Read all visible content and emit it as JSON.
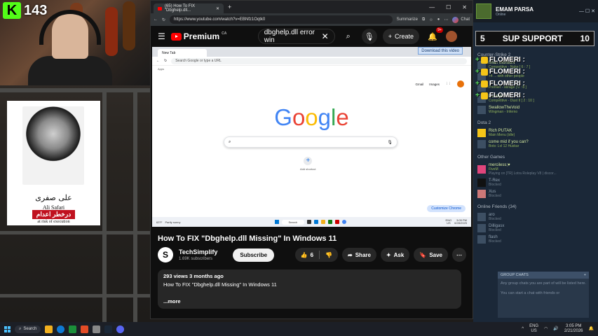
{
  "kick": {
    "count": "143"
  },
  "poster": {
    "name_fa": "علی صفری",
    "name_en": "Ali Safari",
    "red_label": "درخطر اعدام",
    "subtitle": "at risk of execution"
  },
  "browser": {
    "tab_title": "(65) How To FIX \"Dbghelp.dll...",
    "url": "https://www.youtube.com/watch?v=EBNfz1Oqtk0",
    "summarize": "Summarize",
    "chat": "Chat"
  },
  "youtube": {
    "logo": "Premium",
    "region": "CA",
    "search_value": "dbghelp.dll error win",
    "create_label": "Create",
    "notif_count": "9+",
    "video_title": "How To FIX \"Dbghelp.dll Missing\" In Windows 11",
    "channel_name": "TechSimplify",
    "subscribers": "1.69K subscribers",
    "subscribe_label": "Subscribe",
    "likes": "6",
    "share_label": "Share",
    "ask_label": "Ask",
    "save_label": "Save",
    "desc_stats": "293 views  3 months ago",
    "desc_text": "How To FIX \"Dbghelp.dll Missing\" In Windows 11",
    "more_label": "...more"
  },
  "inner": {
    "tab": "New Tab",
    "download_banner": "Download this video",
    "address_placeholder": "Search Google or type a URL",
    "apps": "Apps",
    "gmail": "Gmail",
    "images": "Images",
    "add_shortcut": "Add shortcut",
    "customize": "Customize Chrome",
    "search": "Search",
    "weather": "63°F",
    "weather_sub": "Partly sunny",
    "lang": "ENG",
    "region": "US",
    "time": "3:05 PM",
    "date": "6/28/2025"
  },
  "overlay": {
    "support_left": "5",
    "support_label": "SUP SUPPORT",
    "support_right": "10",
    "flomeri": "FLOMERI :"
  },
  "steam": {
    "user": "EMAM PARSA",
    "user_status": "Online",
    "section_cs2": "Counter-Strike 2",
    "cs2_friends": [
      {
        "name": "Iman MorisoN",
        "status": "Competitive - Nuke [ 6 : 7 ]"
      },
      {
        "name": "",
        "status": "+4 ... with other people"
      },
      {
        "name": "",
        "status": "Premier - Mirage [ 0 : 8 ]"
      },
      {
        "name": "Pouriya1",
        "status": "Competitive - Dust II [ 2 : 10 ]"
      },
      {
        "name": "SwallowTheVoid",
        "status": "Wingman - Inferno"
      }
    ],
    "section_dota": "Dota 2",
    "dota_friends": [
      {
        "name": "Rich PUTAK",
        "status": "Main Menu (idle)"
      },
      {
        "name": "come mid if you can?",
        "status": "Bots: Lvl 12 Huskar"
      }
    ],
    "section_other": "Other Games",
    "other_friends": [
      {
        "name": "merciless;♥",
        "status": "FiveM",
        "sub": "Playing on [TR] Lotra Roleplay V8 | discor..."
      },
      {
        "name": "T-Rex",
        "status": "Blocked"
      },
      {
        "name": "Xus",
        "status": "Blocked"
      }
    ],
    "section_online": "Online Friends",
    "online_count": "(34)",
    "online_friends": [
      {
        "name": "aro",
        "status": "Blocked"
      },
      {
        "name": "Dilligasx",
        "status": "Blocked"
      },
      {
        "name": "flash",
        "status": "Blocked"
      }
    ],
    "group_header": "GROUP CHATS",
    "group_text1": "Any group chats you are part of will be listed here.",
    "group_text2": "You can start a chat with friends or"
  },
  "taskbar": {
    "search": "Search",
    "lang": "ENG",
    "region": "US",
    "time": "3:05 PM",
    "date": "2/21/2026"
  }
}
